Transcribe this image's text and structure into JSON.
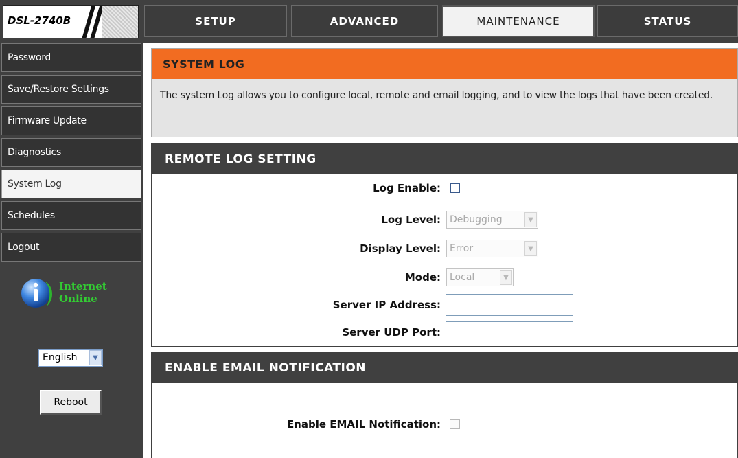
{
  "header": {
    "model": "DSL-2740B",
    "tabs": [
      {
        "label": "SETUP",
        "active": false
      },
      {
        "label": "ADVANCED",
        "active": false
      },
      {
        "label": "MAINTENANCE",
        "active": true
      },
      {
        "label": "STATUS",
        "active": false
      }
    ]
  },
  "sidebar": {
    "items": [
      {
        "label": "Password"
      },
      {
        "label": "Save/Restore Settings"
      },
      {
        "label": "Firmware Update"
      },
      {
        "label": "Diagnostics"
      },
      {
        "label": "System Log",
        "active": true
      },
      {
        "label": "Schedules"
      },
      {
        "label": "Logout"
      }
    ],
    "internet_status": {
      "line1": "Internet",
      "line2": "Online"
    },
    "language": "English",
    "reboot_label": "Reboot"
  },
  "system_log": {
    "title": "SYSTEM LOG",
    "description": "The system Log allows you to configure local, remote and email logging, and to view the logs that have been created."
  },
  "remote_log": {
    "title": "REMOTE LOG SETTING",
    "log_enable_label": "Log Enable:",
    "log_enable_checked": false,
    "log_level_label": "Log Level:",
    "log_level_value": "Debugging",
    "display_level_label": "Display Level:",
    "display_level_value": "Error",
    "mode_label": "Mode:",
    "mode_value": "Local",
    "server_ip_label": "Server IP Address:",
    "server_ip_value": "",
    "server_port_label": "Server UDP Port:",
    "server_port_value": ""
  },
  "email_notification": {
    "title": "ENABLE EMAIL NOTIFICATION",
    "enable_label": "Enable EMAIL Notification:",
    "enable_checked": false
  },
  "colors": {
    "accent_orange": "#f26c21",
    "header_dark": "#404040",
    "online_green": "#33cc33"
  }
}
